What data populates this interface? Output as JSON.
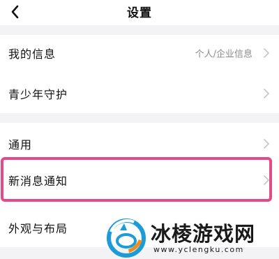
{
  "header": {
    "title": "设置",
    "back_icon": "chevron-left-icon"
  },
  "settings": {
    "my_info": {
      "label": "我的信息",
      "value": "个人/企业信息"
    },
    "youth_protection": {
      "label": "青少年守护"
    },
    "general": {
      "label": "通用"
    },
    "notifications": {
      "label": "新消息通知"
    },
    "appearance": {
      "label": "外观与布局"
    }
  },
  "highlight": {
    "target": "新消息通知",
    "color": "#e24b85"
  },
  "watermark": {
    "title": "冰棱游戏网",
    "url": "www.yclengku.com",
    "logo_icon": "ice-logo-icon",
    "logo_colors": [
      "#1b9bd7",
      "#f28c1c"
    ]
  },
  "colors": {
    "background": "#ffffff",
    "section_gap": "#f3f3f5",
    "text_primary": "#111111",
    "text_secondary": "#8a8a8a",
    "chevron": "#c4c4c4"
  }
}
